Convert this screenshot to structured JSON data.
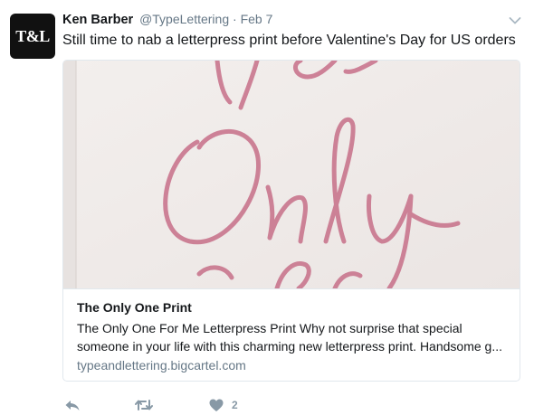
{
  "author": {
    "avatar_text": "T&L",
    "name": "Ken Barber",
    "handle": "@TypeLettering",
    "separator": "·",
    "date": "Feb 7"
  },
  "tweet": {
    "text": "Still time to nab a letterpress print before Valentine's Day for US orders"
  },
  "card": {
    "title": "The Only One Print",
    "description": "The Only One For Me Letterpress Print Why not surprise that special someone in your life with this charming new letterpress print. Handsome g...",
    "domain": "typeandlettering.bigcartel.com"
  },
  "actions": {
    "reply_icon": "reply-icon",
    "retweet_icon": "retweet-icon",
    "like_icon": "heart-icon",
    "like_count": "2"
  },
  "colors": {
    "text": "#14171a",
    "secondary": "#657786",
    "icon": "#8899a6",
    "border": "#e1e8ed",
    "lettering": "#c9768e"
  }
}
